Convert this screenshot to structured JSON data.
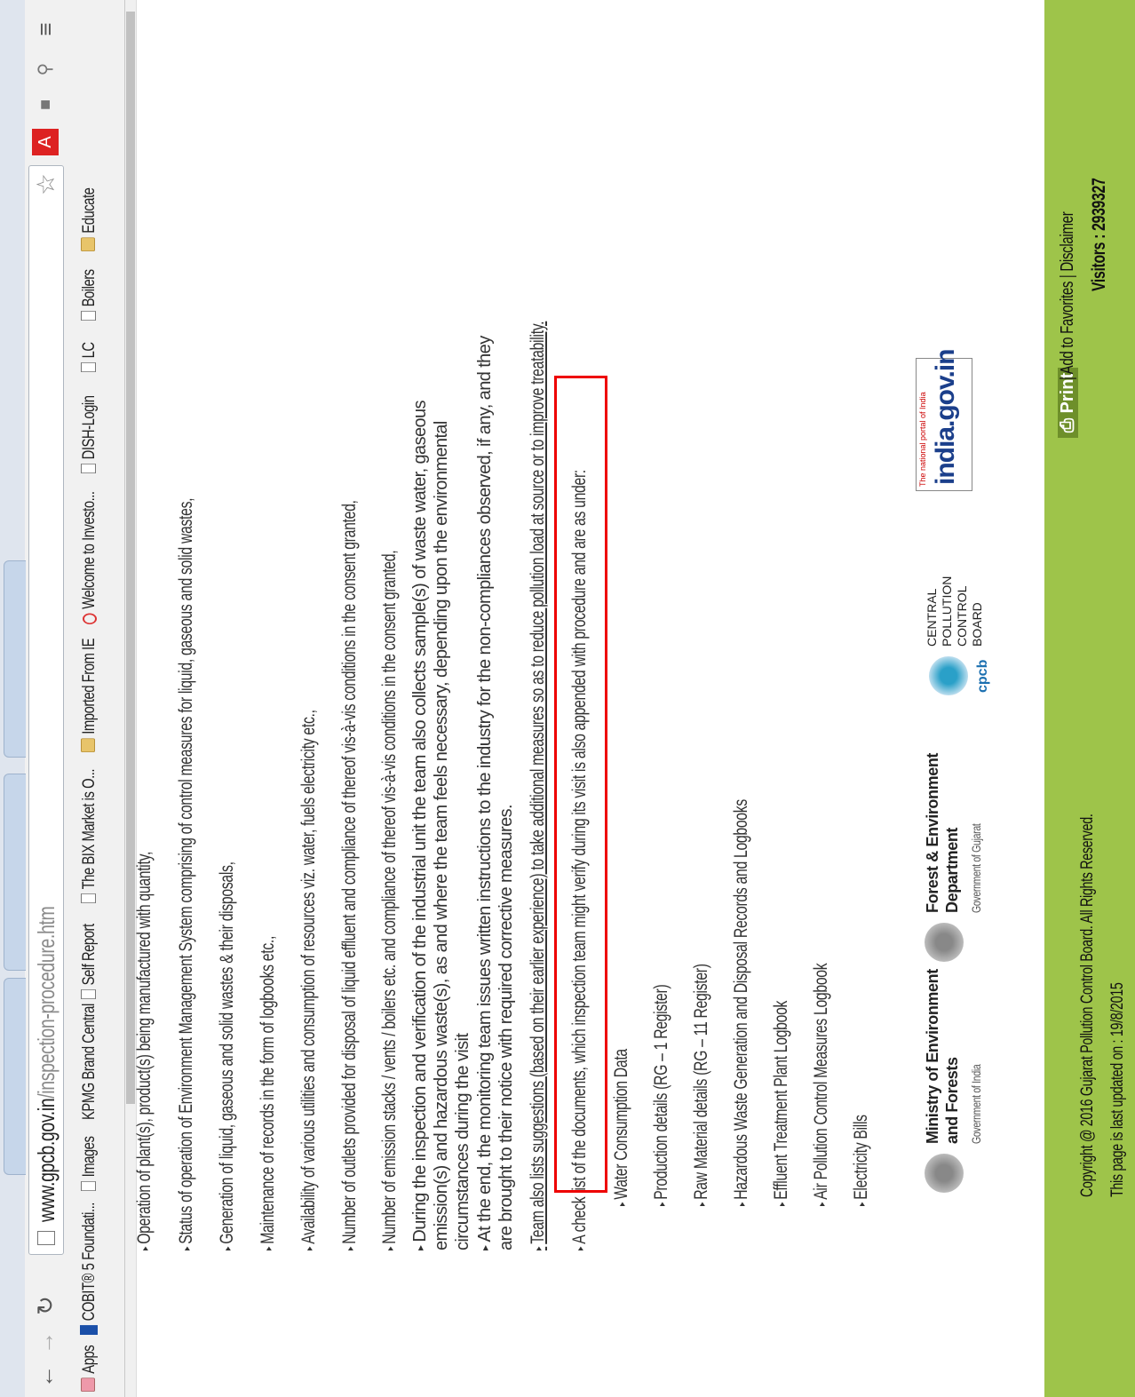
{
  "browser": {
    "url_host": "www.gpcb.gov.in",
    "url_path": "/inspection-procedure.htm",
    "bookmarks": [
      {
        "label": "Apps",
        "icon": "apps-grid-icon"
      },
      {
        "label": "COBIT® 5 Foundati...",
        "icon": "cobit-icon"
      },
      {
        "label": "Images",
        "icon": "page-icon"
      },
      {
        "label": "KPMG Brand Central",
        "icon": "kpmg-icon"
      },
      {
        "label": "Self Report",
        "icon": "page-icon"
      },
      {
        "label": "The BIX Market is O...",
        "icon": "page-icon"
      },
      {
        "label": "Imported From IE",
        "icon": "folder-icon"
      },
      {
        "label": "Welcome to Investo...",
        "icon": "globe-icon"
      },
      {
        "label": "DISH-Login",
        "icon": "page-icon"
      },
      {
        "label": "LC",
        "icon": "page-icon"
      },
      {
        "label": "Boilers",
        "icon": "page-icon"
      },
      {
        "label": "Educate",
        "icon": "folder-icon"
      }
    ]
  },
  "content": {
    "items": [
      "Operation of plant(s), product(s) being manufactured with quantity,",
      "Status of operation of Environment Management System comprising of control measures for liquid, gaseous and solid wastes,",
      "Generation of liquid, gaseous and solid wastes & their disposals,",
      "Maintenance of records in the form of logbooks etc.,",
      "Availability of various utilities and consumption of resources viz. water, fuels electricity etc.,",
      "Number of outlets provided for disposal of liquid effluent and compliance of thereof vis-à-vis conditions in the consent granted,",
      "Number of emission stacks / vents / boilers etc. and compliance of thereof vis-à-vis conditions in the consent granted,",
      "During the inspection and verification of the industrial unit the team also collects sample(s) of waste water, gaseous emission(s) and hazardous waste(s), as and where the team feels necessary, depending upon the environmental circumstances during the visit",
      "At the end, the monitoring team issues written instructions to the industry for the non-compliances observed, if any, and they are brought to their notice with required corrective measures.",
      "Team also lists suggestions (based on their earlier experience) to take additional measures so as to reduce pollution load at source or to improve treatability.",
      "A check list of the documents, which inspection team might verify during its visit is also appended with procedure and are as under:"
    ],
    "checklist": [
      "Water Consumption Data",
      "Production details (RG – 1 Register)",
      "Raw Material details (RG – 11 Register)",
      "Hazardous Waste Generation and Disposal Records and Logbooks",
      "Effluent Treatment Plant Logbook",
      "Air Pollution Control Measures Logbook",
      "Electricity Bills"
    ]
  },
  "logos": {
    "moef_title": "Ministry of Environment and Forests",
    "moef_sub": "Government of India",
    "fed_title": "Forest & Environment Department",
    "fed_sub": "Government of Gujarat",
    "cpcb_lines": [
      "CENTRAL",
      "POLLUTION",
      "CONTROL",
      "BOARD"
    ],
    "cpcb_abbr": "cpcb",
    "india_top": "The national portal of India",
    "india_main": "india.gov.in"
  },
  "footer": {
    "copyright": "Copyright @ 2016 Gujarat Pollution Control Board. All Rights Reserved.",
    "updated": "This page is last updated on : 19/8/2015",
    "print_label": "Print",
    "links": "| Add to Favorites | Disclaimer",
    "visitors": "Visitors : 2939327",
    "color": "#9ec44a"
  }
}
